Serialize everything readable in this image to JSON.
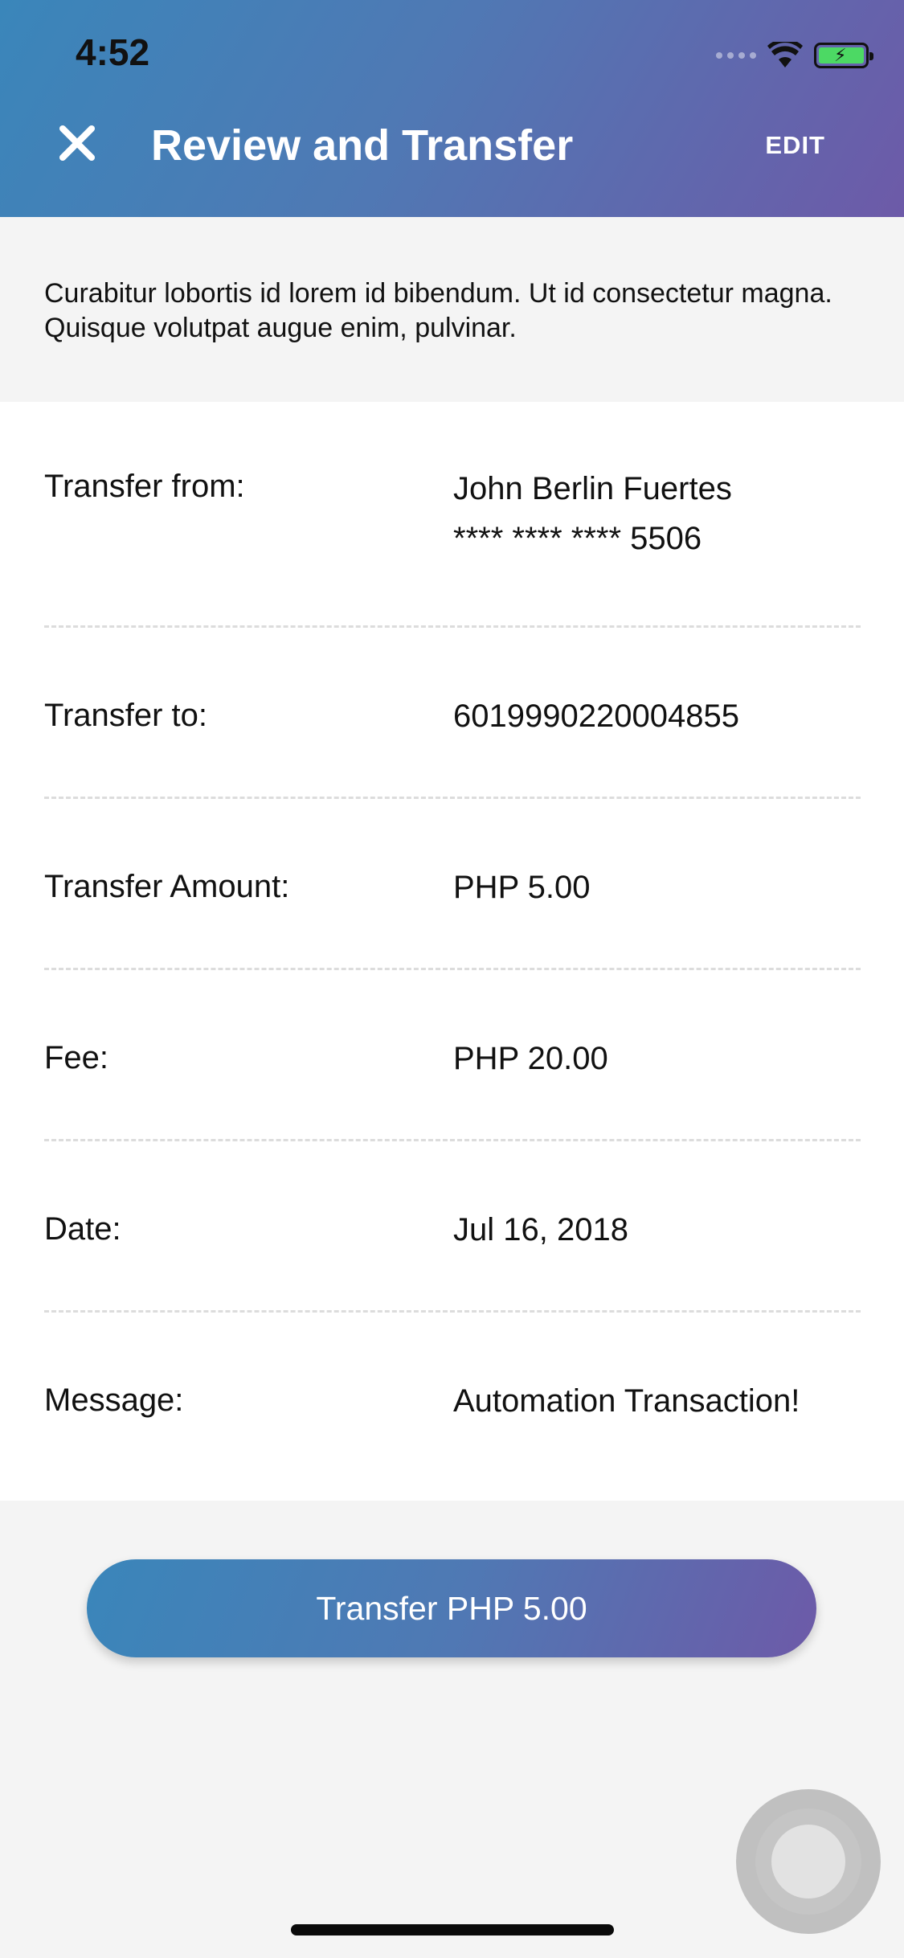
{
  "status_bar": {
    "time": "4:52"
  },
  "header": {
    "title": "Review and Transfer",
    "edit_label": "EDIT"
  },
  "description": "Curabitur lobortis id lorem id bibendum. Ut id consectetur magna. Quisque volutpat augue enim, pulvinar.",
  "details": {
    "from_label": "Transfer from:",
    "from_name": "John Berlin  Fuertes",
    "from_account": "**** **** **** 5506",
    "to_label": "Transfer to:",
    "to_value": "6019990220004855",
    "amount_label": "Transfer Amount:",
    "amount_value": "PHP  5.00",
    "fee_label": "Fee:",
    "fee_value": "PHP 20.00",
    "date_label": "Date:",
    "date_value": "Jul 16, 2018",
    "message_label": "Message:",
    "message_value": "Automation Transaction!"
  },
  "action": {
    "transfer_label": "Transfer PHP  5.00"
  },
  "colors": {
    "gradient_start": "#3a86ba",
    "gradient_end": "#6d5aa8",
    "battery": "#4cd964"
  },
  "icons": {
    "close": "close-icon",
    "wifi": "wifi-icon",
    "battery": "battery-icon",
    "signal": "signal-icon"
  }
}
